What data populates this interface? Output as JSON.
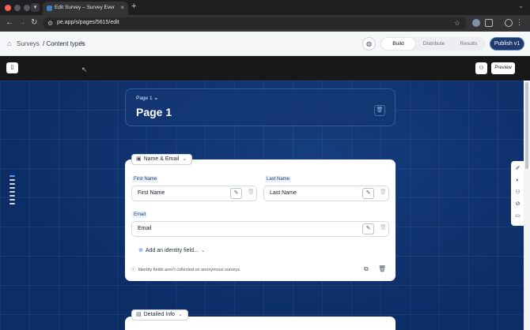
{
  "browser": {
    "tab_title": "Edit Survey – Survey Everywh",
    "new_tab": "+",
    "url": "pe.app/s/pages/5615/edit"
  },
  "header": {
    "breadcrumb_root": "Surveys",
    "breadcrumb_current": "/ Content types",
    "segments": [
      "Build",
      "Distribute",
      "Results"
    ],
    "publish_label": "Publish v1"
  },
  "toolbar": {
    "preview_label": "Preview"
  },
  "page": {
    "small_label": "Page 1",
    "title": "Page 1"
  },
  "section": {
    "name": "Name & Email",
    "fields": [
      {
        "label": "First Name",
        "value": "First Name"
      },
      {
        "label": "Last Name",
        "value": "Last Name"
      },
      {
        "label": "Email",
        "value": "Email"
      }
    ],
    "add_identity_label": "Add an identity field...",
    "info_note": "Identity fields aren't collected on anonymous surveys."
  },
  "section2": {
    "name": "Detailed Info"
  },
  "colors": {
    "canvas_bg": "#0c2d66",
    "publish_bg": "#1e3a6e",
    "accent": "#3b82f6"
  },
  "icons": {
    "home": "home-icon",
    "edit": "pencil-icon",
    "trash": "trash-icon",
    "copy": "copy-icon",
    "info": "info-icon"
  }
}
